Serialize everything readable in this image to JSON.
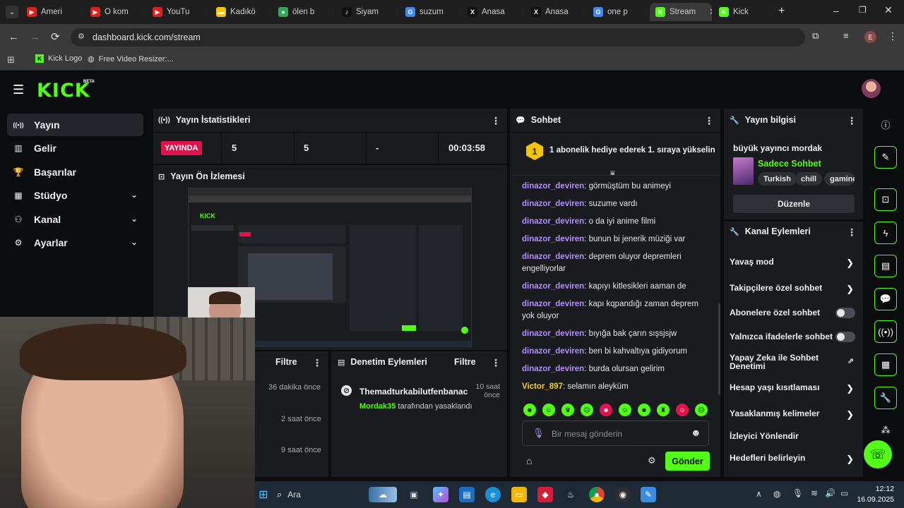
{
  "browser": {
    "tabs": [
      {
        "label": "Ameri",
        "fav_color": "#e02020",
        "fav": "▶"
      },
      {
        "label": "O kom",
        "fav_color": "#e02020",
        "fav": "▶"
      },
      {
        "label": "YouTu",
        "fav_color": "#e02020",
        "fav": "▶"
      },
      {
        "label": "Kadıkö",
        "fav_color": "#f5c400",
        "fav": "▬"
      },
      {
        "label": "ölen b",
        "fav_color": "#35a853",
        "fav": "●"
      },
      {
        "label": "Siyam",
        "fav_color": "#111111",
        "fav": "♪"
      },
      {
        "label": "suzum",
        "fav_color": "#4285f4",
        "fav": "G"
      },
      {
        "label": "Anasa",
        "fav_color": "#111111",
        "fav": "X"
      },
      {
        "label": "Anasa",
        "fav_color": "#111111",
        "fav": "X"
      },
      {
        "label": "one p",
        "fav_color": "#4285f4",
        "fav": "G"
      },
      {
        "label": "Stream",
        "fav_color": "#53fc18",
        "fav": "K"
      },
      {
        "label": "Kick",
        "fav_color": "#53fc18",
        "fav": "K"
      }
    ],
    "url": "dashboard.kick.com/stream",
    "bookmarks": [
      {
        "label": "Kick Logo"
      },
      {
        "label": "Free Video Resizer:..."
      }
    ],
    "profile_initial": "E"
  },
  "header": {
    "logo": "KICK",
    "beta": "BETA"
  },
  "sidebar": {
    "items": [
      {
        "label": "Yayın",
        "icon": "broadcast-icon",
        "glyph": "((•))"
      },
      {
        "label": "Gelir",
        "icon": "chart-icon",
        "glyph": "▥"
      },
      {
        "label": "Başarılar",
        "icon": "trophy-icon",
        "glyph": "🏆"
      },
      {
        "label": "Stüdyo",
        "icon": "studio-icon",
        "glyph": "▦"
      },
      {
        "label": "Kanal",
        "icon": "users-icon",
        "glyph": "⚇"
      },
      {
        "label": "Ayarlar",
        "icon": "gear-icon",
        "glyph": "⚙"
      }
    ]
  },
  "stats": {
    "title": "Yayın İstatistikleri",
    "live": "YAYINDA",
    "viewers": "5",
    "followers": "5",
    "dash": "-",
    "duration": "00:03:58"
  },
  "preview": {
    "title": "Yayın Ön İzlemesi"
  },
  "log": {
    "filter": "Filtre",
    "times": [
      "36 dakika önce",
      "2 saat önce",
      "9 saat önce"
    ]
  },
  "moderation": {
    "title": "Denetim Eylemleri",
    "filter": "Filtre",
    "entry_user": "Themadturkabilutfenbanac",
    "entry_time": "10 saat önce",
    "entry_by": "Mordak35",
    "entry_suffix": " tarafından yasaklandı"
  },
  "chat": {
    "title": "Sohbet",
    "banner_rank": "1",
    "banner": "1 abonelik hediye ederek 1. sıraya yükselin",
    "messages": [
      {
        "user": "dinazor_deviren",
        "text": "görmüştüm bu animeyi"
      },
      {
        "user": "dinazor_deviren",
        "text": "suzume vardı"
      },
      {
        "user": "dinazor_deviren",
        "text": "o da iyi anime filmi"
      },
      {
        "user": "dinazor_deviren",
        "text": "bunun bi jenerik müziği var"
      },
      {
        "user": "dinazor_deviren",
        "text": "deprem oluyor depremleri engelliyorlar"
      },
      {
        "user": "dinazor_deviren",
        "text": "kapıyı kitlesikleri aaman de"
      },
      {
        "user": "dinazor_deviren",
        "text": "kapı kqpandığı zaman deprem yok oluyor"
      },
      {
        "user": "dinazor_deviren",
        "text": "bıyığa bak çarın sışsjsjw"
      },
      {
        "user": "dinazor_deviren",
        "text": "ben bi kahvaltıya gidiyorum"
      },
      {
        "user": "dinazor_deviren",
        "text": "burda olursan gelirim"
      },
      {
        "user": "Victor_897",
        "text": "selamın aleyküm"
      }
    ],
    "placeholder": "Bir mesaj gönderin",
    "send": "Gönder"
  },
  "info": {
    "title": "Yayın bilgisi",
    "stream_title": "büyük yayıncı mordak",
    "category": "Sadece Sohbet",
    "tags": [
      "Turkish",
      "chill",
      "gaming"
    ],
    "edit": "Düzenle"
  },
  "actions": {
    "title": "Kanal Eylemleri",
    "items": [
      {
        "label": "Yavaş mod",
        "kind": "chevron"
      },
      {
        "label": "Takipçilere özel sohbet",
        "kind": "chevron"
      },
      {
        "label": "Abonelere özel sohbet",
        "kind": "toggle"
      },
      {
        "label": "Yalnızca ifadelerle sohbet",
        "kind": "toggle"
      },
      {
        "label": "Yapay Zeka ile Sohbet Denetimi",
        "kind": "external"
      },
      {
        "label": "Hesap yaşı kısıtlaması",
        "kind": "chevron"
      },
      {
        "label": "Yasaklanmış kelimeler",
        "kind": "chevron"
      },
      {
        "label": "İzleyici Yönlendir",
        "kind": "none"
      },
      {
        "label": "Hedefleri belirleyin",
        "kind": "chevron"
      }
    ]
  },
  "taskbar": {
    "search": "Ara",
    "time": "12:12",
    "date": "16.09.2025"
  },
  "colors": {
    "accent": "#53fc18",
    "live": "#e0144c",
    "username": "#b28dff"
  }
}
